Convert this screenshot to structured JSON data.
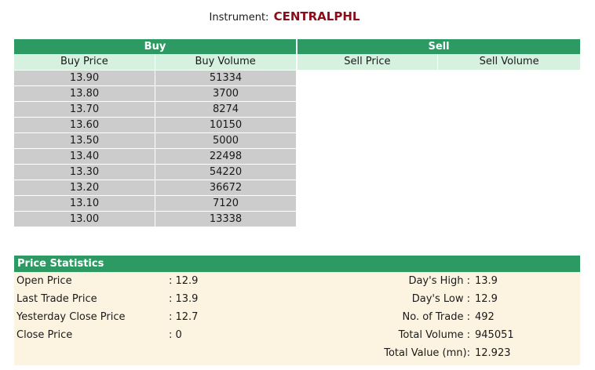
{
  "instrument": {
    "label": "Instrument:",
    "symbol": "CENTRALPHL"
  },
  "depth": {
    "buy_header": "Buy",
    "sell_header": "Sell",
    "columns": [
      "Buy Price",
      "Buy Volume",
      "Sell Price",
      "Sell Volume"
    ],
    "buy_rows": [
      {
        "price": "13.90",
        "volume": "51334"
      },
      {
        "price": "13.80",
        "volume": "3700"
      },
      {
        "price": "13.70",
        "volume": "8274"
      },
      {
        "price": "13.60",
        "volume": "10150"
      },
      {
        "price": "13.50",
        "volume": "5000"
      },
      {
        "price": "13.40",
        "volume": "22498"
      },
      {
        "price": "13.30",
        "volume": "54220"
      },
      {
        "price": "13.20",
        "volume": "36672"
      },
      {
        "price": "13.10",
        "volume": "7120"
      },
      {
        "price": "13.00",
        "volume": "13338"
      }
    ]
  },
  "stats": {
    "header": "Price Statistics",
    "left": [
      {
        "label": "Open Price",
        "value": ": 12.9"
      },
      {
        "label": "Last Trade Price",
        "value": ": 13.9"
      },
      {
        "label": "Yesterday Close Price",
        "value": ": 12.7"
      },
      {
        "label": "Close Price",
        "value": ": 0"
      }
    ],
    "right": [
      {
        "label": "Day's High :",
        "value": "13.9"
      },
      {
        "label": "Day's Low :",
        "value": "12.9"
      },
      {
        "label": "No. of Trade :",
        "value": "492"
      },
      {
        "label": "Total Volume :",
        "value": "945051"
      },
      {
        "label": "Total Value (mn):",
        "value": "12.923"
      }
    ]
  }
}
